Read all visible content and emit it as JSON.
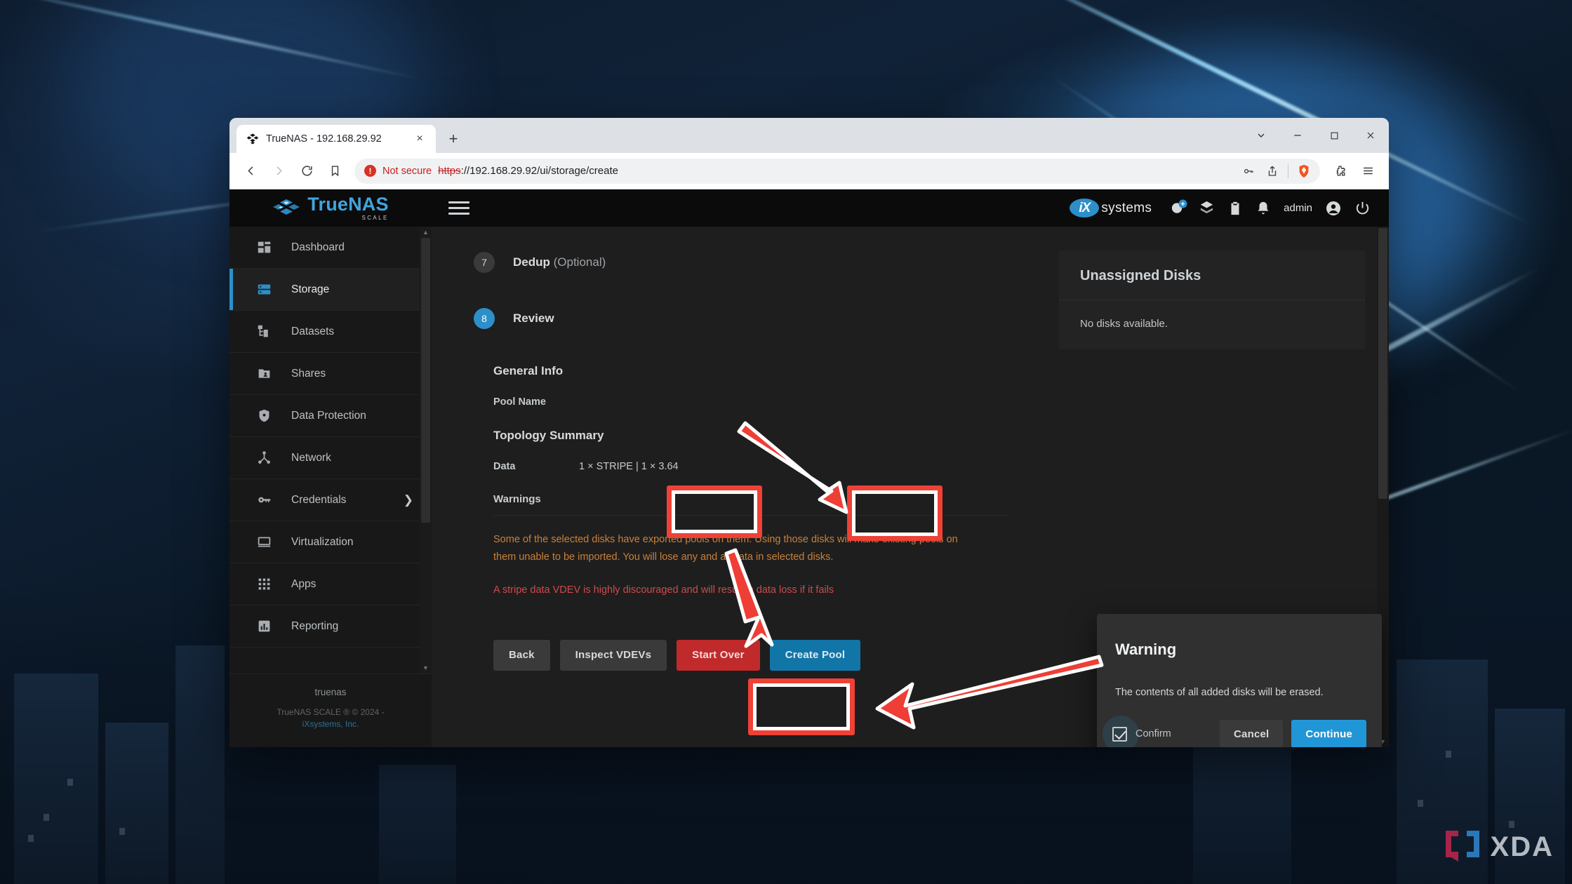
{
  "browser": {
    "tab": {
      "title": "TrueNAS - 192.168.29.92",
      "favicon_name": "truenas-favicon",
      "close_label": "×"
    },
    "newtab_label": "+",
    "window_controls": {
      "expand": "chevron-down",
      "minimize": "−",
      "maximize": "□",
      "close": "✕"
    },
    "omnibox": {
      "security_badge": "!",
      "security_text": "Not secure",
      "url_scheme": "https",
      "url_rest": "://192.168.29.92/ui/storage/create"
    },
    "omni_actions": [
      "password-key-icon",
      "share-icon",
      "brave-shield-icon"
    ],
    "menu_icons": [
      "extensions-puzzle-icon",
      "browser-menu-icon"
    ]
  },
  "app": {
    "brand": {
      "true": "True",
      "nas": "NAS",
      "sub": "SCALE"
    },
    "topbar_right": {
      "vendor_mark": "iX",
      "vendor_text": "systems",
      "icons": [
        "add-user-icon",
        "layers-icon",
        "clipboard-icon",
        "bell-icon"
      ],
      "user": "admin",
      "account_icon": "account-circle-icon",
      "power_icon": "power-icon"
    },
    "sidebar": {
      "items": [
        {
          "label": "Dashboard",
          "icon": "dashboard-icon",
          "active": false,
          "chevron": ""
        },
        {
          "label": "Storage",
          "icon": "storage-icon",
          "active": true,
          "chevron": ""
        },
        {
          "label": "Datasets",
          "icon": "datasets-icon",
          "active": false,
          "chevron": ""
        },
        {
          "label": "Shares",
          "icon": "shares-icon",
          "active": false,
          "chevron": ""
        },
        {
          "label": "Data Protection",
          "icon": "shield-icon",
          "active": false,
          "chevron": ""
        },
        {
          "label": "Network",
          "icon": "network-icon",
          "active": false,
          "chevron": ""
        },
        {
          "label": "Credentials",
          "icon": "key-icon",
          "active": false,
          "chevron": "❯"
        },
        {
          "label": "Virtualization",
          "icon": "monitor-icon",
          "active": false,
          "chevron": ""
        },
        {
          "label": "Apps",
          "icon": "apps-grid-icon",
          "active": false,
          "chevron": ""
        },
        {
          "label": "Reporting",
          "icon": "reporting-icon",
          "active": false,
          "chevron": ""
        }
      ],
      "footer": {
        "hostname": "truenas",
        "copyright": "TrueNAS SCALE ® © 2024 -",
        "company": "iXsystems, Inc."
      }
    },
    "wizard": {
      "steps": [
        {
          "num": "7",
          "label": "Dedup",
          "optional": "(Optional)",
          "state": "done"
        },
        {
          "num": "8",
          "label": "Review",
          "optional": "",
          "state": "active"
        }
      ],
      "general_info_title": "General Info",
      "pool_name_key": "Pool Name",
      "pool_name_value": "",
      "topology_title": "Topology Summary",
      "data_key": "Data",
      "data_value": "1 × STRIPE | 1 × 3.64",
      "warnings_title": "Warnings",
      "warning_orange": "Some of the selected disks have exported pools on them. Using those disks will make existing pools on them unable to be imported. You will lose any and all data in selected disks.",
      "warning_red": "A stripe data VDEV is highly discouraged and will result in data loss if it fails",
      "buttons": {
        "back": "Back",
        "inspect": "Inspect VDEVs",
        "start_over": "Start Over",
        "create_pool": "Create Pool"
      }
    },
    "right_panel": {
      "title": "Unassigned Disks",
      "empty_text": "No disks available."
    }
  },
  "dialog": {
    "title": "Warning",
    "message": "The contents of all added disks will be erased.",
    "confirm_label": "Confirm",
    "confirm_checked": true,
    "cancel_label": "Cancel",
    "continue_label": "Continue"
  },
  "watermark": {
    "text": "XDA"
  },
  "colors": {
    "accent_blue": "#2c8fc9",
    "button_blue": "#1275a8",
    "danger_red": "#c02a2a",
    "warning_orange": "#c8803a",
    "warning_red": "#cf4a4a",
    "annotation_red": "#ef4136",
    "sidebar_bg": "#181818",
    "content_bg": "#1e1e1e"
  }
}
